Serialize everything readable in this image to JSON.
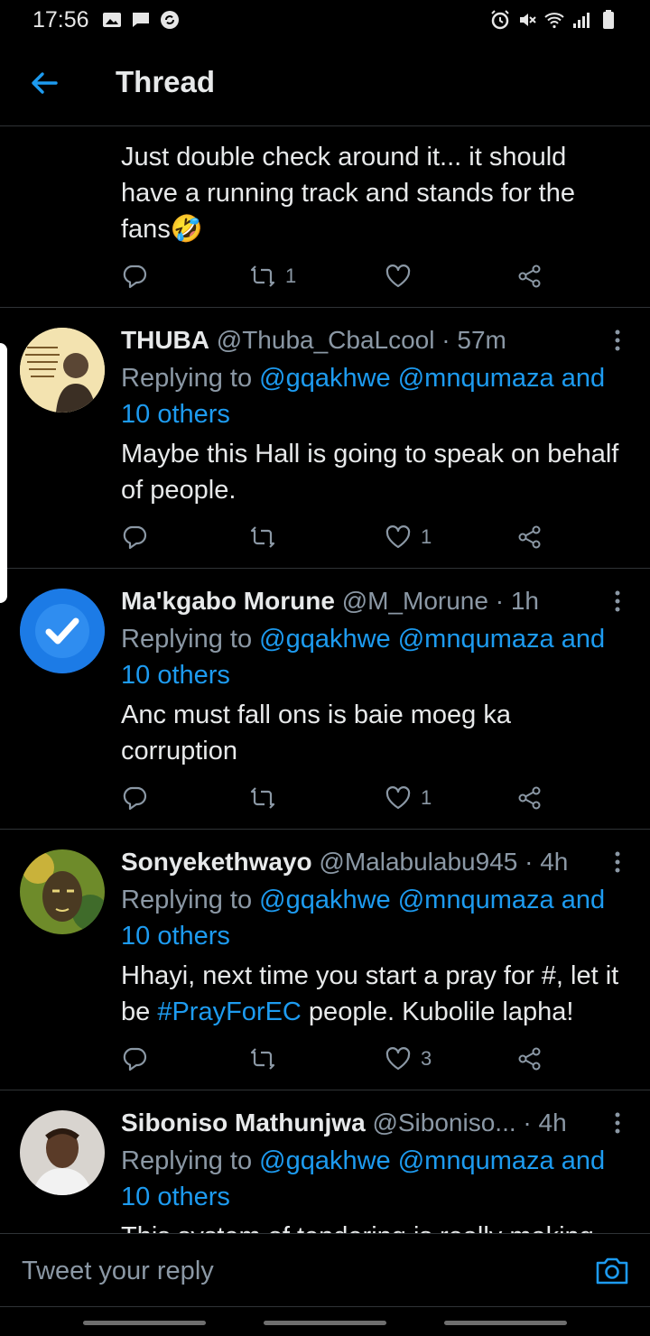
{
  "status_bar": {
    "time": "17:56",
    "left_icons": [
      "image-icon",
      "message-icon",
      "sync-icon"
    ],
    "right_icons": [
      "alarm-icon",
      "mute-icon",
      "wifi-icon",
      "signal-icon",
      "battery-icon"
    ]
  },
  "header": {
    "title": "Thread",
    "back_icon": "arrow-left-icon"
  },
  "colors": {
    "background": "#000000",
    "accent": "#1d9bf0",
    "text": "#e7e9ea",
    "muted": "#8b98a5",
    "divider": "#2f3336"
  },
  "top_tweet": {
    "text": "Just double check around it... it should have a running track and stands for the fans🤣",
    "retweets": "1"
  },
  "replies": [
    {
      "name": "THUBA",
      "handle": "@Thuba_CbaLcool",
      "time": "· 57m",
      "replying_prefix": "Replying to ",
      "mentions": "@gqakhwe @mnqumaza and 10 others",
      "text_before": "Maybe this Hall is going to speak on behalf of people.",
      "hashtag": "",
      "text_after": "",
      "likes": "1",
      "avatar_text": "I freed a thousand slaves. I could have freed a thousand more if only they knew they were slaves."
    },
    {
      "name": "Ma'kgabo Morune",
      "handle": "@M_Morune",
      "time": "· 1h",
      "replying_prefix": "Replying to ",
      "mentions": "@gqakhwe @mnqumaza and 10 others",
      "text_before": "Anc must fall ons is baie moeg ka corruption",
      "hashtag": "",
      "text_after": "",
      "likes": "1"
    },
    {
      "name": "Sonyekethwayo",
      "handle": "@Malabulabu945",
      "time": "· 4h",
      "replying_prefix": "Replying to ",
      "mentions": "@gqakhwe @mnqumaza and 10 others",
      "text_before": "Hhayi, next time you start a pray for #, let it be ",
      "hashtag": "#PrayForEC",
      "text_after": " people. Kubolile lapha!",
      "likes": "3"
    },
    {
      "name": "Siboniso Mathunjwa",
      "handle": "@Siboniso...",
      "time": "· 4h",
      "replying_prefix": "Replying to ",
      "mentions": "@gqakhwe @mnqumaza and 10 others",
      "text_before": "This system of tendering is really making",
      "hashtag": "",
      "text_after": "",
      "likes": ""
    }
  ],
  "composer": {
    "placeholder": "Tweet your reply",
    "camera_icon": "camera-icon"
  }
}
